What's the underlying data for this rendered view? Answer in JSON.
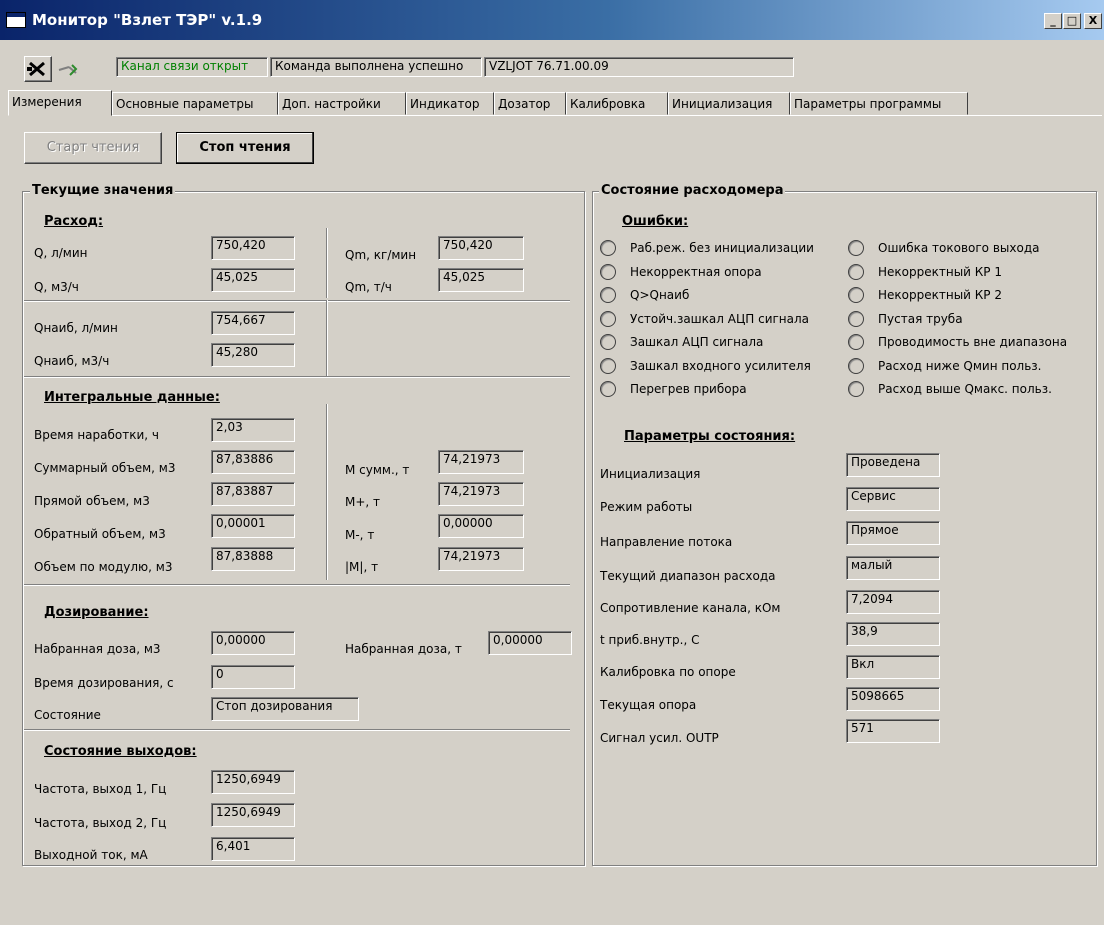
{
  "window": {
    "title": "Монитор \"Взлет ТЭР\" v.1.9",
    "controls": [
      "_",
      "□",
      "X"
    ]
  },
  "toolbar": {
    "status_fields": [
      "Канал связи открыт",
      "Команда выполнена успешно",
      "VZLJOT 76.71.00.09"
    ],
    "status_colors": {
      "channel": "#008000"
    }
  },
  "tabs": [
    "Измерения",
    "Основные параметры",
    "Доп. настройки",
    "Индикатор",
    "Дозатор",
    "Калибровка",
    "Инициализация",
    "Параметры программы"
  ],
  "buttons": {
    "start": "Старт чтения",
    "stop": "Стоп чтения"
  },
  "current": {
    "title": "Текущие значения",
    "flow": {
      "title": "Расход:",
      "q_lmin": {
        "label": "Q, л/мин",
        "value": "750,420"
      },
      "q_m3h": {
        "label": "Q, м3/ч",
        "value": "45,025"
      },
      "qm_kgmin": {
        "label": "Qm, кг/мин",
        "value": "750,420"
      },
      "qm_th": {
        "label": "Qm, т/ч",
        "value": "45,025"
      },
      "qmax_lmin": {
        "label": "Qнаиб, л/мин",
        "value": "754,667"
      },
      "qmax_m3h": {
        "label": "Qнаиб, м3/ч",
        "value": "45,280"
      }
    },
    "integral": {
      "title": "Интегральные данные:",
      "runtime": {
        "label": "Время наработки, ч",
        "value": "2,03"
      },
      "total": {
        "label": "Суммарный объем, м3",
        "value": "87,83886"
      },
      "forward": {
        "label": "Прямой объем, м3",
        "value": "87,83887"
      },
      "reverse": {
        "label": "Обратный объем, м3",
        "value": "0,00001"
      },
      "modulus": {
        "label": "Объем по модулю, м3",
        "value": "87,83888"
      },
      "m_sum": {
        "label": "М сумм., т",
        "value": "74,21973"
      },
      "m_plus": {
        "label": "М+, т",
        "value": "74,21973"
      },
      "m_minus": {
        "label": "М-, т",
        "value": "0,00000"
      },
      "m_abs": {
        "label": "|M|, т",
        "value": "74,21973"
      }
    },
    "dosing": {
      "title": "Дозирование:",
      "dose_m3": {
        "label": "Набранная доза, м3",
        "value": "0,00000"
      },
      "dose_t": {
        "label": "Набранная доза, т",
        "value": "0,00000"
      },
      "time": {
        "label": "Время дозирования, с",
        "value": "0"
      },
      "state": {
        "label": "Состояние",
        "value": "Стоп дозирования"
      }
    },
    "outputs": {
      "title": "Состояние выходов:",
      "freq1": {
        "label": "Частота, выход 1, Гц",
        "value": "1250,6949"
      },
      "freq2": {
        "label": "Частота, выход 2, Гц",
        "value": "1250,6949"
      },
      "current": {
        "label": "Выходной ток, мА",
        "value": "6,401"
      }
    }
  },
  "meter": {
    "title": "Состояние расходомера",
    "errors_title": "Ошибки:",
    "errors_left": [
      "Раб.реж. без инициализации",
      "Некорректная опора",
      "Q>Qнаиб",
      "Устойч.зашкал АЦП сигнала",
      "Зашкал АЦП сигнала",
      "Зашкал входного усилителя",
      "Перегрев прибора"
    ],
    "errors_right": [
      "Ошибка токового выхода",
      "Некорректный КР 1",
      "Некорректный КР 2",
      "Пустая труба",
      "Проводимость вне диапазона",
      "Расход ниже Qмин польз.",
      "Расход выше Qмакс. польз."
    ],
    "params_title": "Параметры состояния:",
    "params": [
      {
        "label": "Инициализация",
        "value": "Проведена"
      },
      {
        "label": "Режим работы",
        "value": "Сервис"
      },
      {
        "label": "Направление потока",
        "value": "Прямое"
      },
      {
        "label": "Текущий диапазон расхода",
        "value": "малый"
      },
      {
        "label": "Сопротивление канала, кОм",
        "value": "7,2094"
      },
      {
        "label": "t приб.внутр., С",
        "value": "38,9"
      },
      {
        "label": "Калибровка по опоре",
        "value": "Вкл"
      },
      {
        "label": "Текущая опора",
        "value": "5098665"
      },
      {
        "label": "Сигнал усил. OUTP",
        "value": "571"
      }
    ]
  }
}
